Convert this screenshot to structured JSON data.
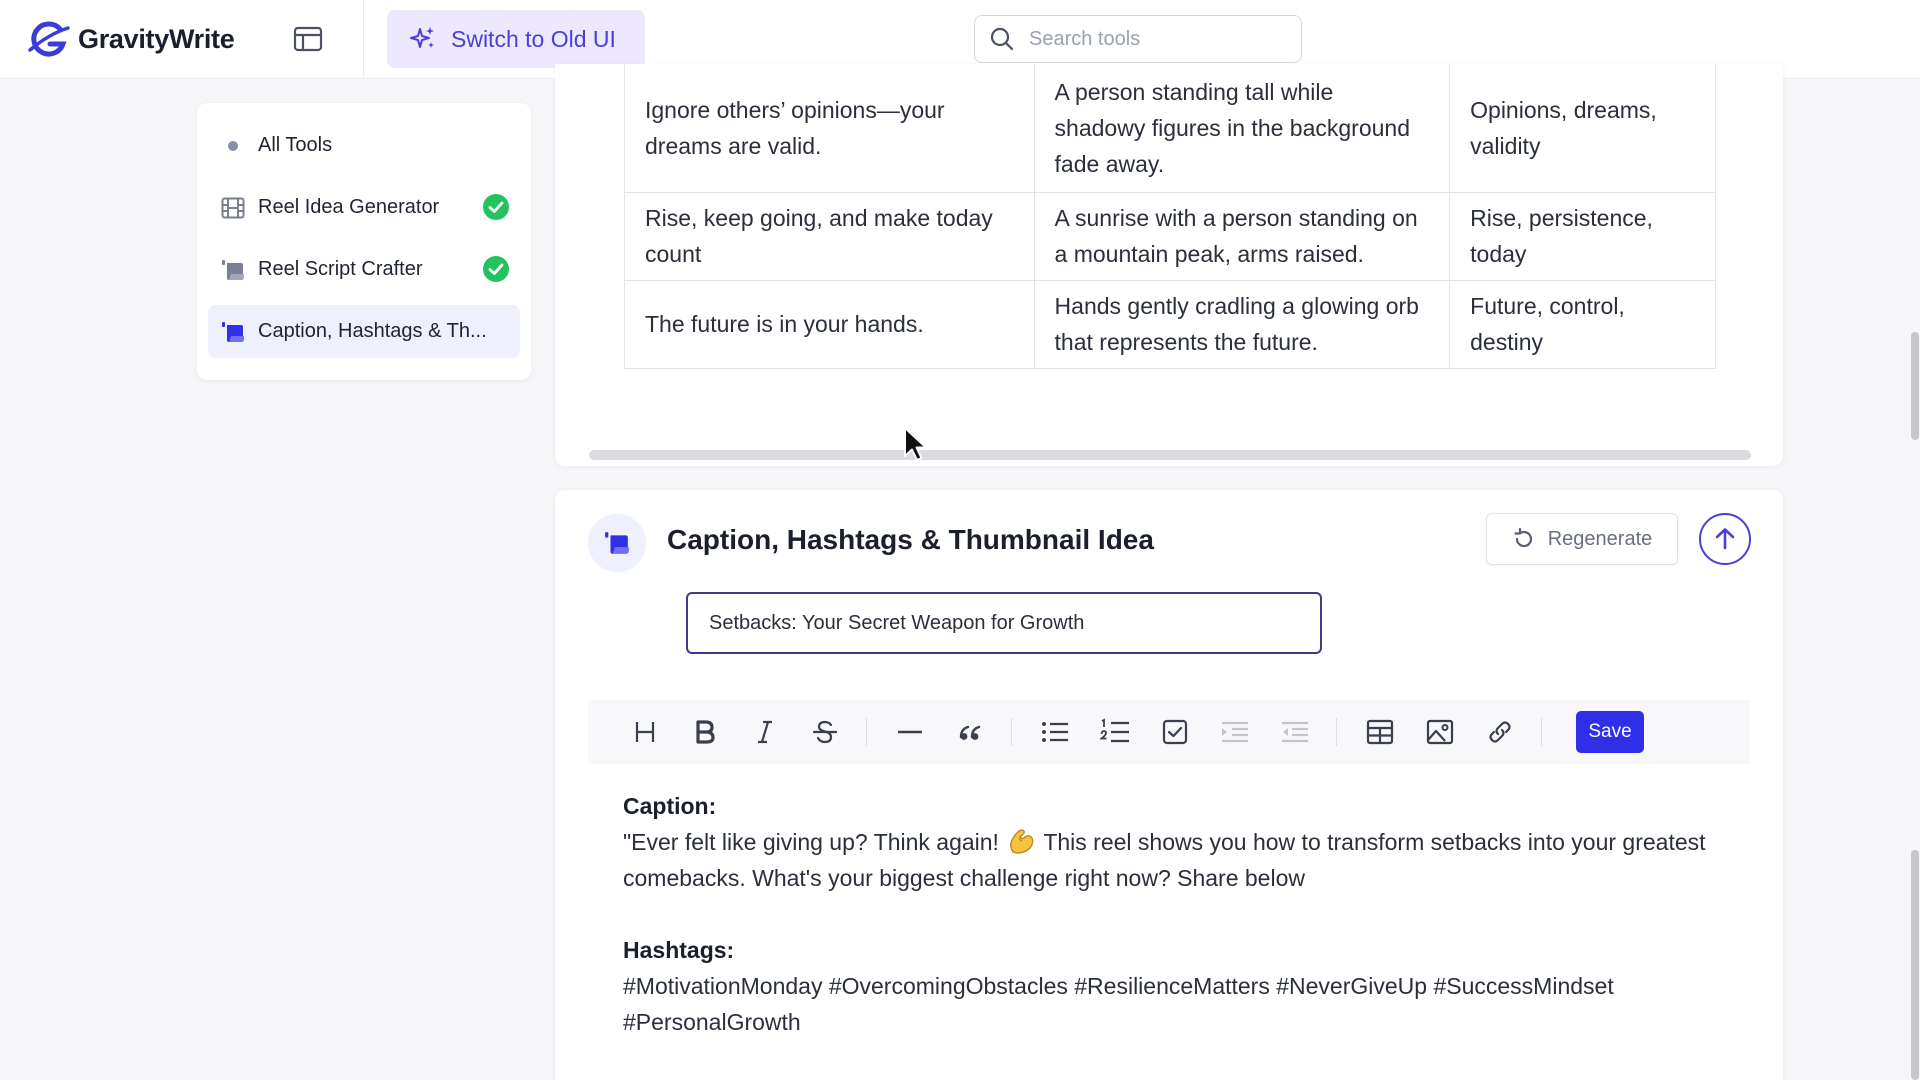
{
  "app": {
    "brand_name": "GravityWrite",
    "brand_color": "#3b3bd6",
    "accent_color": "#2f2fe8",
    "switch_label": "Switch to Old UI",
    "search_placeholder": "Search tools"
  },
  "sidebar": {
    "items": [
      {
        "label": "All Tools",
        "icon": "dot-icon",
        "completed": false,
        "active": false
      },
      {
        "label": "Reel Idea Generator",
        "icon": "film-icon",
        "completed": true,
        "active": false
      },
      {
        "label": "Reel Script Crafter",
        "icon": "script-icon",
        "completed": true,
        "active": false
      },
      {
        "label": "Caption, Hashtags & Th...",
        "icon": "script-icon",
        "completed": false,
        "active": true
      }
    ]
  },
  "ideas_table": {
    "rows": [
      [
        "Ignore others’ opinions—your dreams are valid.",
        "A person standing tall while shadowy figures in the background fade away.",
        "Opinions, dreams, validity"
      ],
      [
        "Rise, keep going, and make today count",
        "A sunrise with a person standing on a mountain peak, arms raised.",
        "Rise, persistence, today"
      ],
      [
        "The future is in your hands.",
        "Hands gently cradling a glowing orb that represents the future.",
        "Future, control, destiny"
      ]
    ]
  },
  "tool": {
    "title": "Caption, Hashtags & Thumbnail Idea",
    "regenerate_label": "Regenerate",
    "topic_value": "Setbacks: Your Secret Weapon for Growth",
    "save_label": "Save",
    "toolbar_icons": [
      "heading-icon",
      "bold-icon",
      "italic-icon",
      "strikethrough-icon",
      "horizontal-rule-icon",
      "quote-icon",
      "bullet-list-icon",
      "numbered-list-icon",
      "checklist-icon",
      "indent-icon",
      "outdent-icon",
      "table-icon",
      "image-icon",
      "link-icon"
    ]
  },
  "editor": {
    "caption_heading": "Caption:",
    "caption_text_part1": "\"Ever felt like giving up? Think again!",
    "caption_emoji": "flexed-biceps-emoji",
    "caption_text_part2": "This reel shows you how to transform setbacks into your greatest comebacks. What's your biggest challenge right now? Share below",
    "hashtags_heading": "Hashtags:",
    "hashtags_text": "#MotivationMonday #OvercomingObstacles #ResilienceMatters #NeverGiveUp #SuccessMindset #PersonalGrowth"
  }
}
